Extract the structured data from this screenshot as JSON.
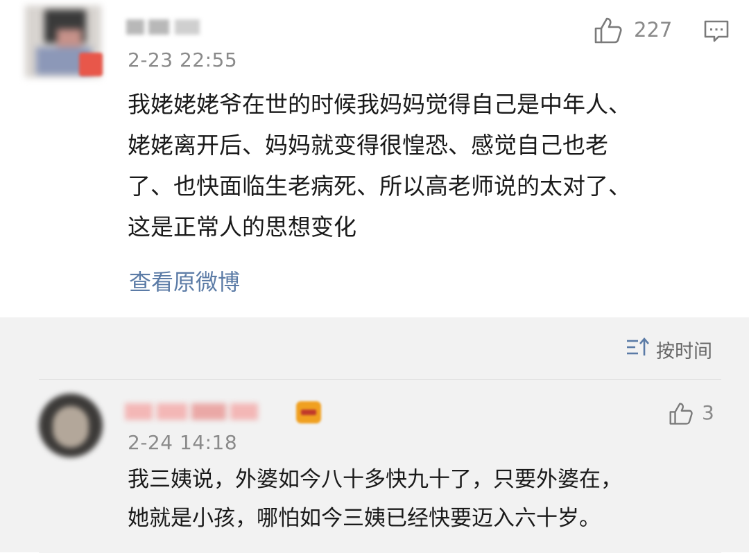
{
  "comment": {
    "time": "2-23 22:55",
    "likes": "227",
    "lines": [
      "我姥姥姥爷在世的时候我妈妈觉得自己是中年人、",
      "姥姥离开后、妈妈就变得很惶恐、感觉自己也老",
      "了、也快面临生老病死、所以高老师说的太对了、",
      "这是正常人的思想变化"
    ],
    "view_original": "查看原微博"
  },
  "sort": {
    "label": "按时间"
  },
  "reply": {
    "time": "2-24 14:18",
    "likes": "3",
    "lines": [
      "我三姨说，外婆如今八十多快九十了，只要外婆在，",
      "她就是小孩，哪怕如今三姨已经快要迈入六十岁。"
    ]
  },
  "icons": {
    "like": "thumbs-up-icon",
    "comment": "comment-icon",
    "sort": "sort-icon",
    "vip": "vip-badge-icon"
  },
  "colors": {
    "link": "#5b7ba6",
    "meta": "#8a8a8a",
    "text": "#1a1a1a",
    "band": "#f2f2f2"
  }
}
